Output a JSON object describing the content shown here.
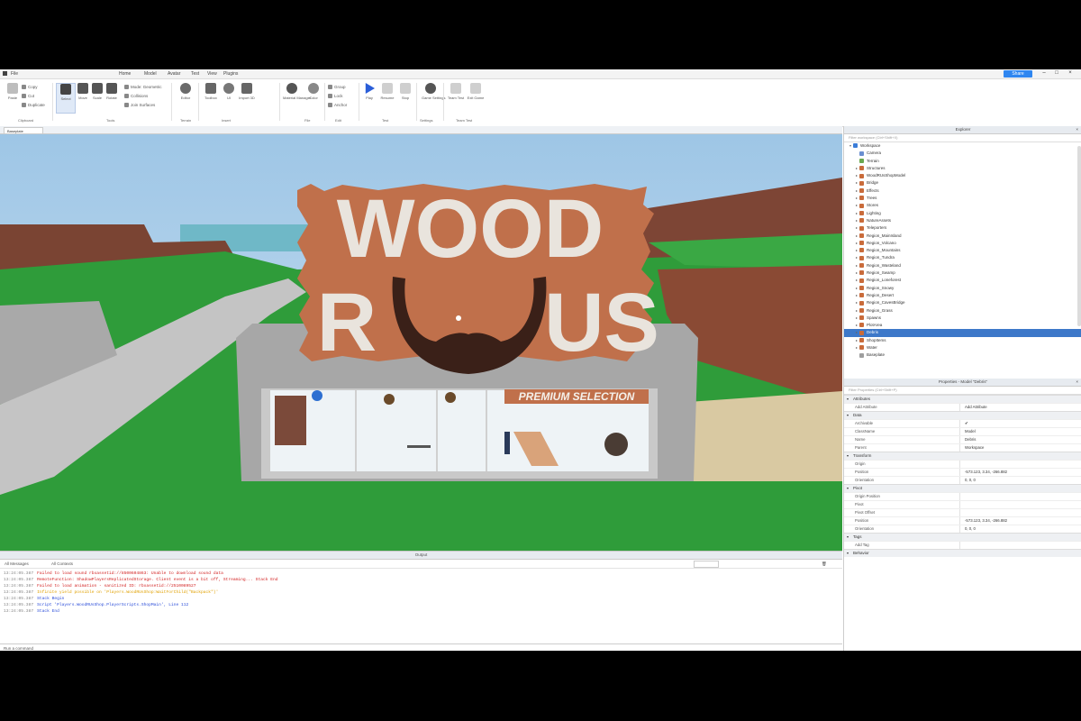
{
  "menubar": {
    "items": [
      "File",
      "Home",
      "Model",
      "Avatar",
      "Test",
      "View",
      "Plugins"
    ],
    "share_label": "Share"
  },
  "ribbon": {
    "clipboard": [
      "Paste",
      "Copy",
      "Cut",
      "Duplicate"
    ],
    "tools": [
      "Select",
      "Move",
      "Scale",
      "Rotate",
      "Transform"
    ],
    "tool_options": [
      "Mode: Geometric",
      "Collisions",
      "Join Surfaces"
    ],
    "terrain": [
      "Editor"
    ],
    "insert": [
      "Toolbox",
      "UI",
      "Import 3D"
    ],
    "file": [
      "Material Manager",
      "Color"
    ],
    "edit": [
      "Group",
      "Lock",
      "Anchor"
    ],
    "test": [
      "Play",
      "Resume",
      "Stop"
    ],
    "settings": [
      "Game Settings"
    ],
    "team_test": [
      "Team Test",
      "Exit Game"
    ],
    "groups": [
      "Clipboard",
      "Tools",
      "Terrain",
      "Insert",
      "File",
      "Edit",
      "Test",
      "Settings",
      "Team Test"
    ]
  },
  "viewport": {
    "tab_label": "Baseplate",
    "sign_line1": "WOOD",
    "sign_line2_left": "R",
    "sign_line2_right": "US",
    "banner": "PREMIUM SELECTION"
  },
  "output": {
    "title": "Output",
    "filter_left": "All Messages",
    "filter_mid": "All Contexts",
    "cmd_placeholder": "Run a command",
    "lines": [
      {
        "time": "13:24:05.387",
        "level": "err",
        "text": "Failed to load sound rbxassetid://8500604863: Unable to download sound data"
      },
      {
        "time": "13:24:05.387",
        "level": "err",
        "text": "RemoteFunction: ShadowPlayersReplicatedStorage. Client event is a bit off, Streaming... Stack End"
      },
      {
        "time": "13:24:05.387",
        "level": "err",
        "text": "Failed to load animation - sanitized ID: rbxassetid://2510089527"
      },
      {
        "time": "13:24:05.387",
        "level": "warn",
        "text": "Infinite yield possible on 'Players.WoodRUsShop:WaitForChild(\"Backpack\")'"
      },
      {
        "time": "13:24:05.387",
        "level": "info",
        "text": "Stack Begin"
      },
      {
        "time": "13:24:05.387",
        "level": "info",
        "text": "Script 'Players.WoodRUsShop.PlayerScripts.ShopMain', Line 112"
      },
      {
        "time": "13:24:05.387",
        "level": "info",
        "text": "Stack End"
      }
    ]
  },
  "explorer": {
    "title": "Explorer",
    "filter_placeholder": "Filter workspace (Ctrl+Shift+X)",
    "items": [
      {
        "label": "Workspace",
        "depth": 0,
        "arrow": "▾",
        "color": "#3b7dd8"
      },
      {
        "label": "Camera",
        "depth": 1,
        "arrow": "",
        "color": "#6a8fd0"
      },
      {
        "label": "Terrain",
        "depth": 1,
        "arrow": "",
        "color": "#6aa84f"
      },
      {
        "label": "Structures",
        "depth": 1,
        "arrow": "▸",
        "color": "#c96b3a"
      },
      {
        "label": "WoodRUsShopModel",
        "depth": 1,
        "arrow": "▸",
        "color": "#c96b3a"
      },
      {
        "label": "Bridge",
        "depth": 1,
        "arrow": "▸",
        "color": "#c96b3a"
      },
      {
        "label": "Effects",
        "depth": 1,
        "arrow": "▸",
        "color": "#c96b3a"
      },
      {
        "label": "Trees",
        "depth": 1,
        "arrow": "▸",
        "color": "#c96b3a"
      },
      {
        "label": "Stores",
        "depth": 1,
        "arrow": "▸",
        "color": "#c96b3a"
      },
      {
        "label": "Lighting",
        "depth": 1,
        "arrow": "▸",
        "color": "#c96b3a"
      },
      {
        "label": "NatureAssets",
        "depth": 1,
        "arrow": "▸",
        "color": "#c96b3a"
      },
      {
        "label": "Teleporters",
        "depth": 1,
        "arrow": "▸",
        "color": "#c96b3a"
      },
      {
        "label": "Region_MainIsland",
        "depth": 1,
        "arrow": "▸",
        "color": "#c96b3a"
      },
      {
        "label": "Region_Volcano",
        "depth": 1,
        "arrow": "▸",
        "color": "#c96b3a"
      },
      {
        "label": "Region_Mountains",
        "depth": 1,
        "arrow": "▸",
        "color": "#c96b3a"
      },
      {
        "label": "Region_Tundra",
        "depth": 1,
        "arrow": "▸",
        "color": "#c96b3a"
      },
      {
        "label": "Region_Wasteland",
        "depth": 1,
        "arrow": "▸",
        "color": "#c96b3a"
      },
      {
        "label": "Region_Swamp",
        "depth": 1,
        "arrow": "▸",
        "color": "#c96b3a"
      },
      {
        "label": "Region_Loneforest",
        "depth": 1,
        "arrow": "▸",
        "color": "#c96b3a"
      },
      {
        "label": "Region_Snowy",
        "depth": 1,
        "arrow": "▸",
        "color": "#c96b3a"
      },
      {
        "label": "Region_Desert",
        "depth": 1,
        "arrow": "▸",
        "color": "#c96b3a"
      },
      {
        "label": "Region_CavesBridge",
        "depth": 1,
        "arrow": "▸",
        "color": "#c96b3a"
      },
      {
        "label": "Region_Grass",
        "depth": 1,
        "arrow": "▸",
        "color": "#c96b3a"
      },
      {
        "label": "Spawns",
        "depth": 1,
        "arrow": "▸",
        "color": "#c96b3a"
      },
      {
        "label": "PlotArea",
        "depth": 1,
        "arrow": "▸",
        "color": "#c96b3a"
      },
      {
        "label": "Debris",
        "depth": 1,
        "arrow": "▸",
        "color": "#c96b3a",
        "selected": true
      },
      {
        "label": "ShopItems",
        "depth": 1,
        "arrow": "▸",
        "color": "#c96b3a"
      },
      {
        "label": "Water",
        "depth": 1,
        "arrow": "▸",
        "color": "#c96b3a"
      },
      {
        "label": "Baseplate",
        "depth": 1,
        "arrow": "",
        "color": "#9e9e9e"
      }
    ]
  },
  "properties": {
    "title": "Properties - Model \"Debris\"",
    "filter_placeholder": "Filter Properties (Ctrl+Shift+P)",
    "sections": [
      {
        "name": "Attributes",
        "rows": [
          [
            "Add Attribute",
            "Add Attribute"
          ]
        ]
      },
      {
        "name": "Data",
        "rows": [
          [
            "Archivable",
            "✔"
          ],
          [
            "ClassName",
            "Model"
          ],
          [
            "Name",
            "Debris"
          ],
          [
            "Parent",
            "Workspace"
          ]
        ]
      },
      {
        "name": "Transform",
        "rows": [
          [
            "Origin",
            ""
          ],
          [
            "Position",
            "-573.123, 3.34, -266.882"
          ],
          [
            "Orientation",
            "0, 0, 0"
          ]
        ]
      },
      {
        "name": "Pivot",
        "rows": [
          [
            "Origin Position",
            ""
          ],
          [
            "Pivot",
            ""
          ],
          [
            "Pivot Offset",
            ""
          ],
          [
            "Position",
            "-573.123, 3.34, -266.882"
          ],
          [
            "Orientation",
            "0, 0, 0"
          ]
        ]
      },
      {
        "name": "Tags",
        "rows": [
          [
            "Add Tag",
            ""
          ]
        ]
      },
      {
        "name": "Behavior",
        "rows": []
      }
    ]
  },
  "colors": {
    "accent": "#2f86f0",
    "selection": "#3d78c9",
    "sign": "#c0704b",
    "sign_text": "#e9e4dd",
    "banner_text": "#f4f0ea"
  }
}
